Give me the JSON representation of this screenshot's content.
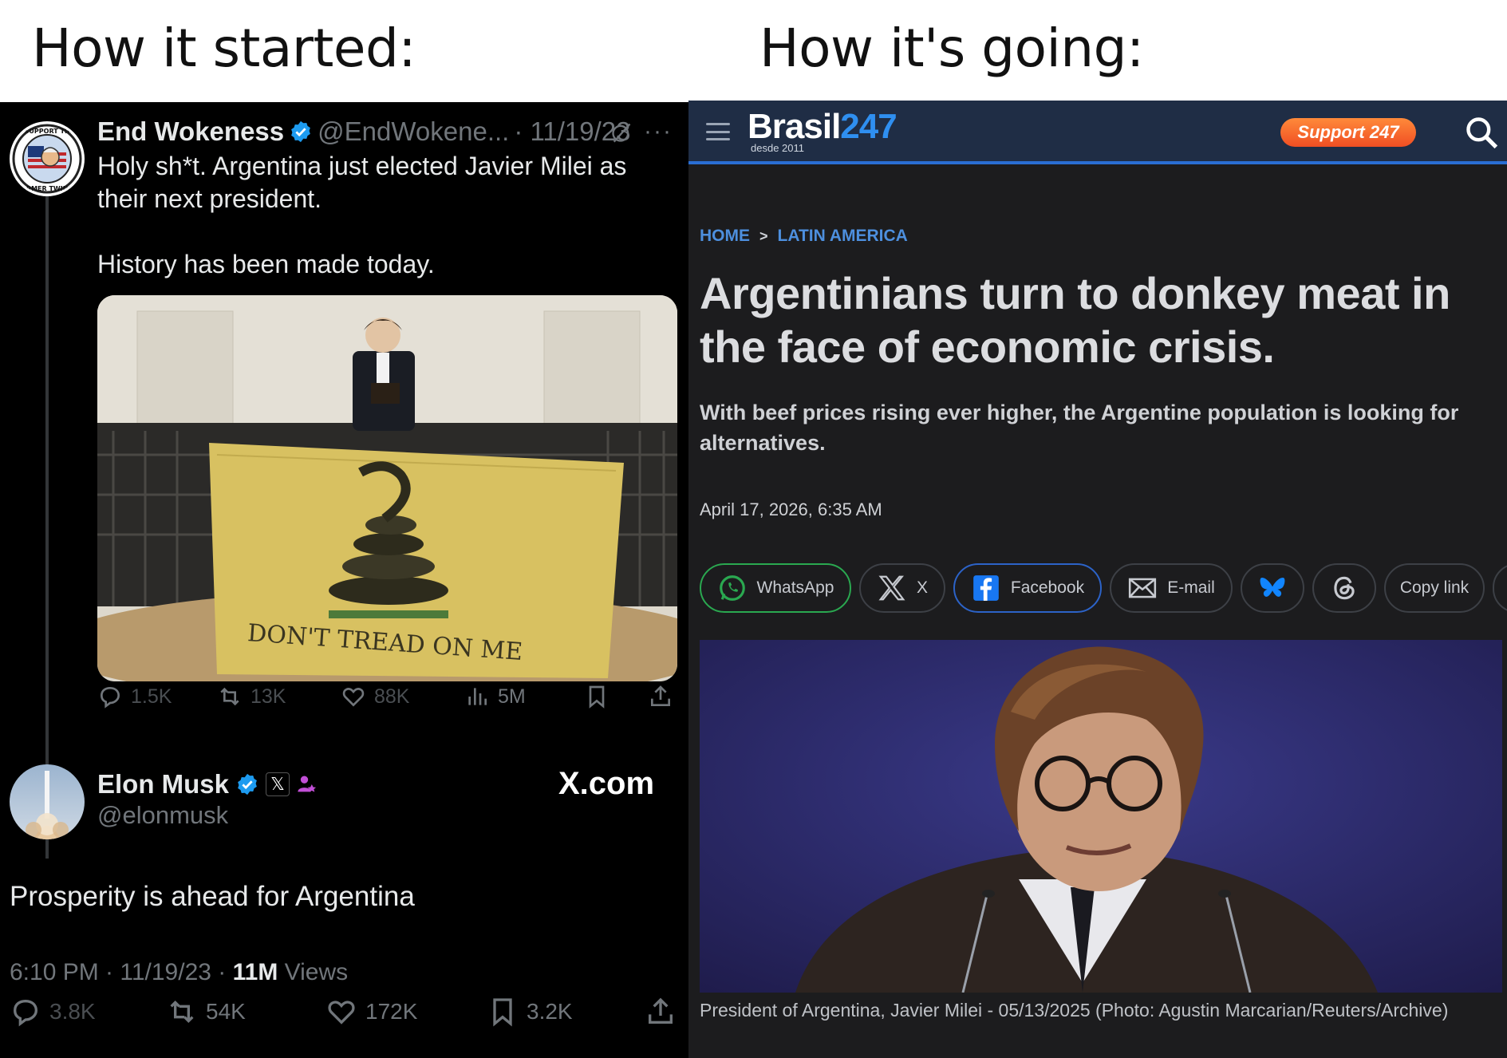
{
  "meme": {
    "left_caption": "How it started:",
    "right_caption": "How it's going:"
  },
  "tweet1": {
    "name": "End Wokeness",
    "handle": "@EndWokene...",
    "date": "· 11/19/23",
    "more": "···",
    "text_line1": "Holy sh*t. Argentina just elected Javier Milei as their next president.",
    "text_line2": "History has been made today.",
    "image_flag_text": "DON'T TREAD ON ME",
    "avatar_text_top": "I SUPPORT THE",
    "avatar_text_bottom": "FORMER TWINKS",
    "replies": "1.5K",
    "retweets": "13K",
    "likes": "88K",
    "views": "5M"
  },
  "tweet2": {
    "name": "Elon Musk",
    "x_badge": "𝕏",
    "handle": "@elonmusk",
    "brand": "X.com",
    "text": "Prosperity is ahead for Argentina",
    "time": "6:10 PM · 11/19/23 · ",
    "views_count": "11M",
    "views_label": " Views",
    "replies": "3.8K",
    "retweets": "54K",
    "likes": "172K",
    "bookmarks": "3.2K"
  },
  "site": {
    "logo_text": "Brasil",
    "logo_num": "247",
    "logo_sub": "desde 2011",
    "support_label": "Support 247",
    "breadcrumb_home": "HOME",
    "breadcrumb_sep": ">",
    "breadcrumb_section": "LATIN AMERICA",
    "headline": "Argentinians turn to donkey meat in the face of economic crisis.",
    "subhead": "With beef prices rising ever higher, the Argentine population is looking for alternatives.",
    "dateline": "April 17, 2026, 6:35 AM",
    "share": {
      "whatsapp": "WhatsApp",
      "x": "X",
      "facebook": "Facebook",
      "email": "E-mail",
      "copy": "Copy link"
    },
    "photo_caption": "President of Argentina, Javier Milei - 05/13/2025 (Photo: Agustin Marcarian/Reuters/Archive)"
  },
  "colors": {
    "x_bg": "#000000",
    "x_verified": "#1d9bf0",
    "site_bg": "#1c1c1e",
    "site_header": "#1f2d45",
    "site_accent": "#2f8ff0",
    "support_orange": "#f04e23",
    "whatsapp_green": "#2aa850",
    "facebook_blue": "#2c63c8"
  },
  "icons": [
    "verified-badge-icon",
    "grok-icon",
    "reply-icon",
    "retweet-icon",
    "like-icon",
    "views-icon",
    "bookmark-icon",
    "share-icon",
    "hamburger-icon",
    "search-icon",
    "whatsapp-icon",
    "x-logo-icon",
    "facebook-icon",
    "mail-icon",
    "bluesky-icon",
    "threads-icon"
  ]
}
